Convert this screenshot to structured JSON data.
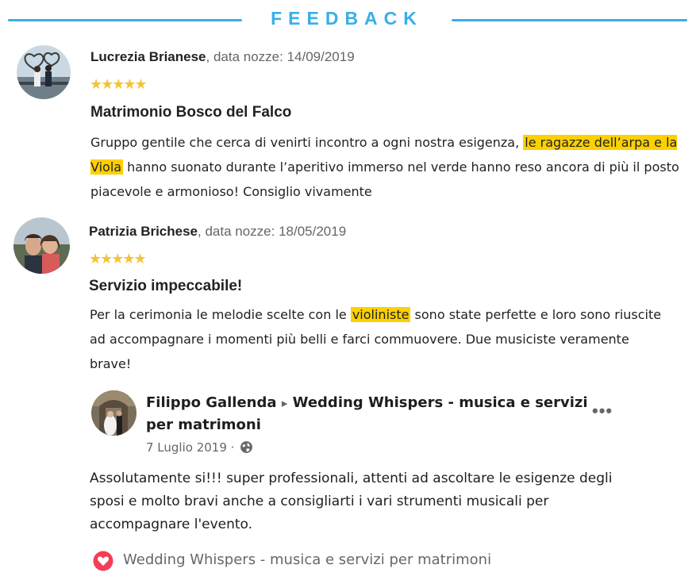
{
  "header": {
    "title": "FEEDBACK"
  },
  "colors": {
    "accent": "#3aaee8",
    "star": "#f2c438",
    "highlight": "#fdd000"
  },
  "reviews": [
    {
      "name": "Lucrezia Brianese",
      "date": ", data nozze: 14/09/2019",
      "stars": "★★★★★",
      "rating": 5,
      "title": "Matrimonio Bosco del Falco",
      "text_before": "Gruppo gentile che cerca di venirti incontro a ogni nostra esigenza, ",
      "text_highlight": "le ragazze dell’arpa e la Viola",
      "text_after": " hanno suonato durante l’aperitivo immerso nel verde hanno reso ancora di più il posto piacevole e armonioso! Consiglio vivamente"
    },
    {
      "name": "Patrizia Brichese",
      "date": ", data nozze: 18/05/2019",
      "stars": "★★★★★",
      "rating": 5,
      "title": "Servizio impeccabile!",
      "text_before": "Per la cerimonia le melodie scelte con le ",
      "text_highlight": "violiniste",
      "text_after": " sono state perfette e loro sono riuscite ad accompagnare i momenti più belli e farci commuovere. Due musiciste veramente brave!"
    }
  ],
  "facebook_post": {
    "author": "Filippo Gallenda",
    "arrow": "▸",
    "page": "Wedding Whispers - musica e servizi per matrimoni",
    "date": "7 Luglio 2019 ·",
    "more": "•••",
    "text": "Assolutamente si!!! super professionali, attenti ad ascoltare le esigenze degli sposi e molto bravi anche a consigliarti i vari strumenti musicali per accompagnare l'evento.",
    "reaction_page": "Wedding Whispers - musica e servizi per matrimoni",
    "icons": {
      "privacy": "globe-icon",
      "reaction": "heart-icon",
      "more": "more-options-icon"
    }
  }
}
